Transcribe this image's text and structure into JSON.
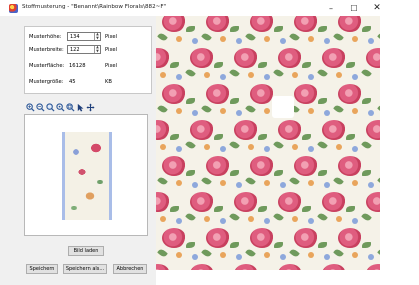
{
  "window": {
    "title": "Stoffmusterung - \"Benannt\\Rainbow Florals\\882~F\"",
    "minimize_glyph": "–",
    "maximize_glyph": "☐",
    "close_glyph": "✕"
  },
  "properties": [
    {
      "label": "Musterhöhe:",
      "value": "134",
      "unit": "Pixel",
      "editable": true
    },
    {
      "label": "Musterbreite:",
      "value": "122",
      "unit": "Pixel",
      "editable": true
    },
    {
      "label": "Musterfläche:",
      "value": "16128",
      "unit": "Pixel",
      "editable": false
    },
    {
      "label": "Mustergröße:",
      "value": "45",
      "unit": "KB",
      "editable": false
    }
  ],
  "toolbar": {
    "icons": [
      "zoom-in-icon",
      "zoom-out-icon",
      "zoom-fit-icon",
      "zoom-actual-icon",
      "zoom-window-icon",
      "pointer-icon",
      "pan-icon"
    ]
  },
  "buttons": {
    "load": "Bild laden",
    "save": "Speichern",
    "save_as": "Speichern als...",
    "cancel": "Abbrechen"
  },
  "colors": {
    "rose": "#d44a69",
    "leaf": "#6f9a5c",
    "blue_flower": "#8ea8dc",
    "orange_flower": "#e9a55c",
    "background": "#f5f2e8"
  }
}
